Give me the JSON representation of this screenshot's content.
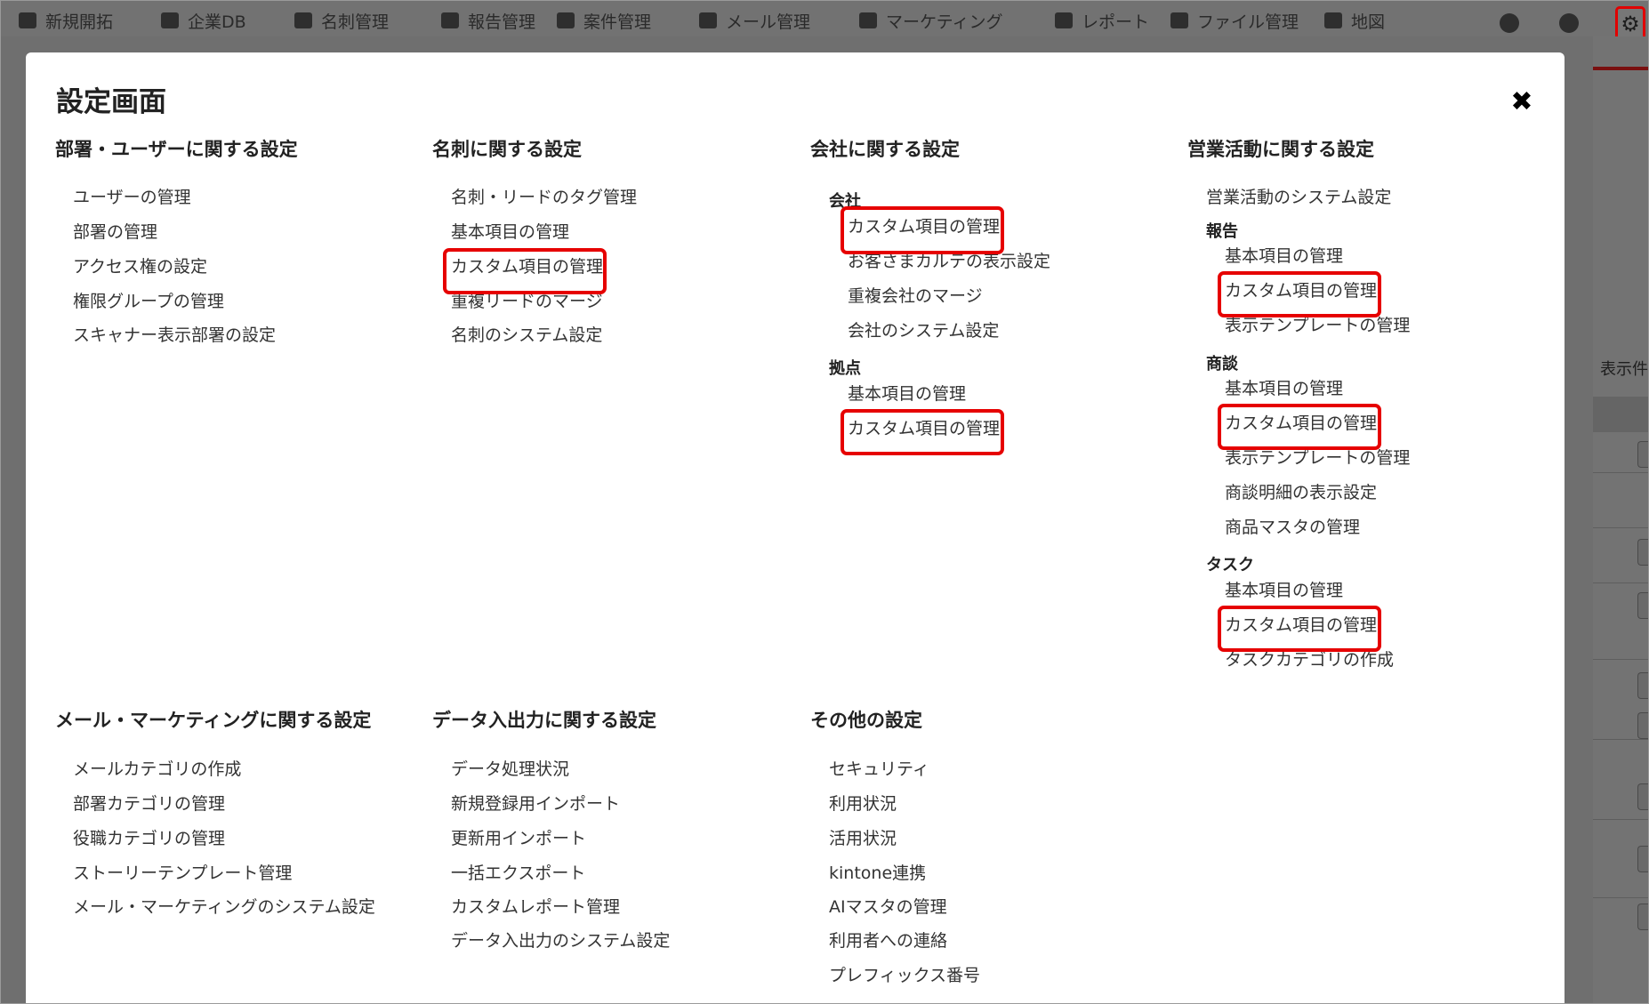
{
  "app": {
    "nav": [
      {
        "label": "新規開拓"
      },
      {
        "label": "企業DB"
      },
      {
        "label": "名刺管理"
      },
      {
        "label": "報告管理"
      },
      {
        "label": "案件管理"
      },
      {
        "label": "メール管理"
      },
      {
        "label": "マーケティング"
      },
      {
        "label": "レポート"
      },
      {
        "label": "ファイル管理"
      },
      {
        "label": "地図"
      }
    ],
    "settings_icon": "gear-icon",
    "background_label": "表示件"
  },
  "modal": {
    "title": "設定画面",
    "close_icon": "close-icon",
    "highlight_color": "#e60000",
    "sections": {
      "users": {
        "heading": "部署・ユーザーに関する設定",
        "items": [
          "ユーザーの管理",
          "部署の管理",
          "アクセス権の設定",
          "権限グループの管理",
          "スキャナー表示部署の設定"
        ]
      },
      "cards": {
        "heading": "名刺に関する設定",
        "items": [
          "名刺・リードのタグ管理",
          "基本項目の管理",
          "カスタム項目の管理",
          "重複リードのマージ",
          "名刺のシステム設定"
        ]
      },
      "company": {
        "heading": "会社に関する設定",
        "group1": {
          "label": "会社",
          "items": [
            "カスタム項目の管理",
            "お客さまカルテの表示設定",
            "重複会社のマージ",
            "会社のシステム設定"
          ]
        },
        "group2": {
          "label": "拠点",
          "items": [
            "基本項目の管理",
            "カスタム項目の管理"
          ]
        }
      },
      "sales": {
        "heading": "営業活動に関する設定",
        "system": "営業活動のシステム設定",
        "group1": {
          "label": "報告",
          "items": [
            "基本項目の管理",
            "カスタム項目の管理",
            "表示テンプレートの管理"
          ]
        },
        "group2": {
          "label": "商談",
          "items": [
            "基本項目の管理",
            "カスタム項目の管理",
            "表示テンプレートの管理",
            "商談明細の表示設定",
            "商品マスタの管理"
          ]
        },
        "group3": {
          "label": "タスク",
          "items": [
            "基本項目の管理",
            "カスタム項目の管理",
            "タスクカテゴリの作成"
          ]
        }
      },
      "mail": {
        "heading": "メール・マーケティングに関する設定",
        "items": [
          "メールカテゴリの作成",
          "部署カテゴリの管理",
          "役職カテゴリの管理",
          "ストーリーテンプレート管理",
          "メール・マーケティングのシステム設定"
        ]
      },
      "data": {
        "heading": "データ入出力に関する設定",
        "items": [
          "データ処理状況",
          "新規登録用インポート",
          "更新用インポート",
          "一括エクスポート",
          "カスタムレポート管理",
          "データ入出力のシステム設定"
        ]
      },
      "other": {
        "heading": "その他の設定",
        "items": [
          "セキュリティ",
          "利用状況",
          "活用状況",
          "kintone連携",
          "AIマスタの管理",
          "利用者への連絡",
          "プレフィックス番号"
        ]
      }
    }
  }
}
